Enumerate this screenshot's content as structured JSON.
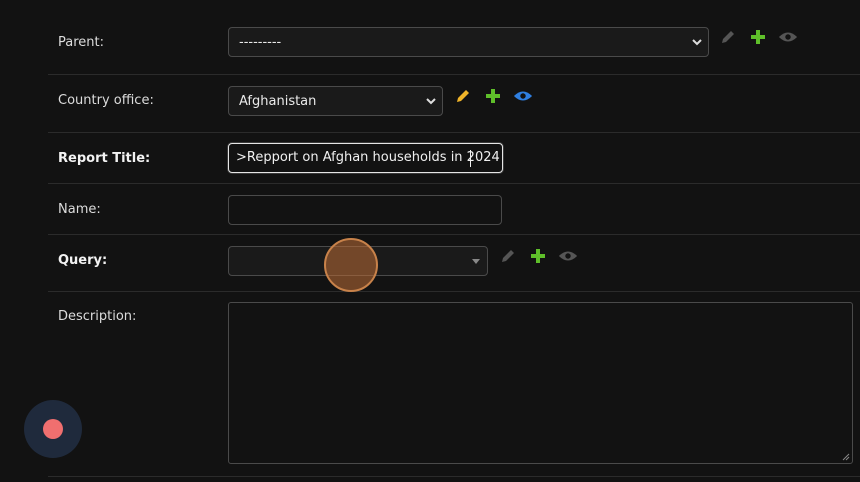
{
  "colors": {
    "edit_active": "#f0b429",
    "add": "#5fbf2a",
    "view_active": "#2f7fe0",
    "disabled_icon": "#555555",
    "record": "#f06f6f"
  },
  "form": {
    "parent": {
      "label": "Parent:",
      "value": "---------"
    },
    "country_office": {
      "label": "Country office:",
      "value": "Afghanistan"
    },
    "report_title": {
      "label": "Report Title:",
      "value": ">Repport on Afghan households in 2024"
    },
    "name": {
      "label": "Name:",
      "value": ""
    },
    "query": {
      "label": "Query:",
      "value": ""
    },
    "description": {
      "label": "Description:",
      "value": ""
    }
  },
  "icons": {
    "edit": "pencil-icon",
    "add": "plus-icon",
    "view": "eye-icon",
    "chevron": "chevron-down-icon",
    "record": "record-icon"
  }
}
